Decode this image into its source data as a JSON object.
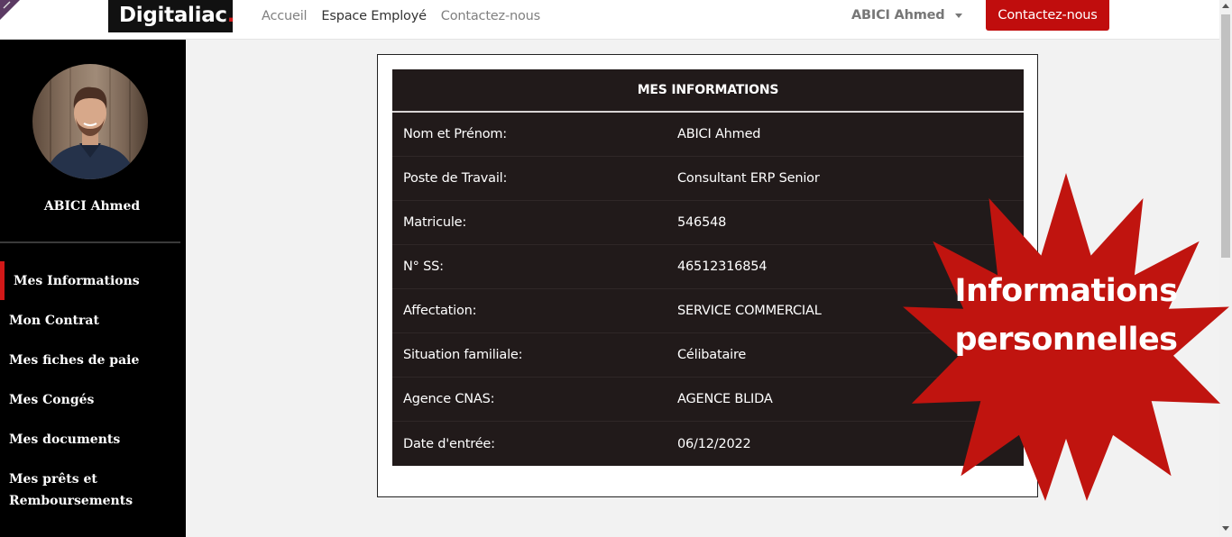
{
  "navbar": {
    "logo_text": "Digitaliac",
    "logo_dot": ".",
    "links": [
      "Accueil",
      "Espace Employé",
      "Contactez-nous"
    ],
    "active_link": "Espace Employé",
    "user_name": "ABICI Ahmed",
    "cta_label": "Contactez-nous"
  },
  "sidebar": {
    "user_name": "ABICI Ahmed",
    "items": [
      {
        "label": "Mes Informations",
        "active": true
      },
      {
        "label": "Mon Contrat"
      },
      {
        "label": "Mes fiches de paie"
      },
      {
        "label": "Mes Congés"
      },
      {
        "label": "Mes documents"
      },
      {
        "label": "Mes prêts et Remboursements"
      }
    ]
  },
  "info_table": {
    "title": "MES INFORMATIONS",
    "rows": [
      {
        "label": "Nom et Prénom:",
        "value": "ABICI Ahmed"
      },
      {
        "label": "Poste de Travail:",
        "value": "Consultant ERP Senior"
      },
      {
        "label": "Matricule:",
        "value": "546548"
      },
      {
        "label": "N° SS:",
        "value": "46512316854"
      },
      {
        "label": "Affectation:",
        "value": "SERVICE COMMERCIAL"
      },
      {
        "label": "Situation familiale:",
        "value": "Célibataire"
      },
      {
        "label": "Agence CNAS:",
        "value": "AGENCE BLIDA"
      },
      {
        "label": "Date d'entrée:",
        "value": "06/12/2022"
      }
    ]
  },
  "badge": {
    "line1": "Informations",
    "line2": "personnelles",
    "color": "#c0140f"
  },
  "colors": {
    "brand_red": "#c00d0d",
    "sidebar_bg": "#000000",
    "table_bg": "#211a1a"
  }
}
